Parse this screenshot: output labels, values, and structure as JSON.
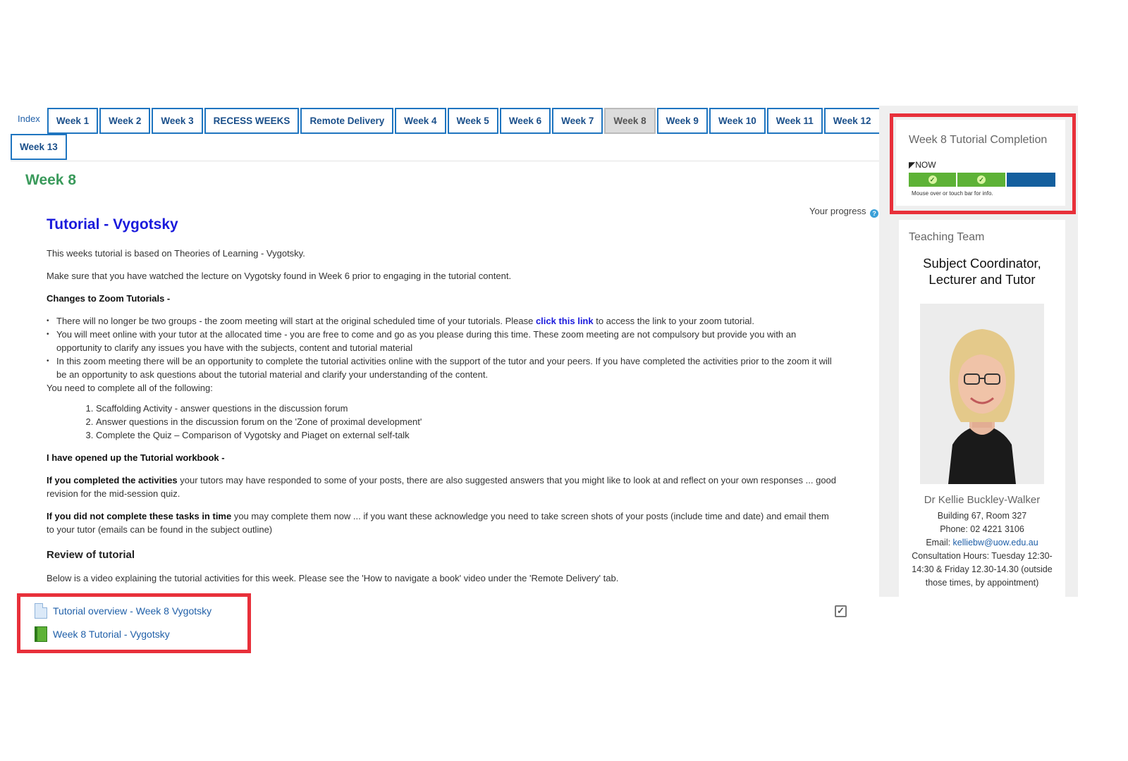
{
  "tabs": {
    "index_label": "Index",
    "items": [
      "Week 1",
      "Week 2",
      "Week 3",
      "RECESS WEEKS",
      "Remote Delivery",
      "Week 4",
      "Week 5",
      "Week 6",
      "Week 7",
      "Week 8",
      "Week 9",
      "Week 10",
      "Week 11",
      "Week 12",
      "Week 13"
    ],
    "active": "Week 8"
  },
  "page": {
    "week_title": "Week 8",
    "your_progress": "Your progress"
  },
  "main": {
    "title": "Tutorial - Vygotsky",
    "intro_1": "This weeks tutorial is based on Theories of Learning - Vygotsky.",
    "intro_2": "Make sure that you have watched the lecture on Vygotsky found in Week 6 prior to engaging in the tutorial content.",
    "changes_heading": "Changes to Zoom Tutorials -",
    "bullet_1_pre": "There will no longer be two groups - the zoom meeting will start at the original scheduled time of your tutorials. Please ",
    "bullet_1_link": "click this link",
    "bullet_1_post": " to access the link to your zoom tutorial.",
    "bullet_2": "You will meet online with your tutor at the allocated time - you are free to come and go as you please during this time. These zoom meeting are not compulsory but provide you with an opportunity to clarify any issues you have with the subjects, content and tutorial material",
    "bullet_3": "In this zoom meeting there will be an opportunity to complete the tutorial activities online with the support of the tutor and your peers. If you have completed the activities prior to the zoom it will be an opportunity to ask questions about the tutorial material and clarify your understanding of the content.",
    "complete_intro": "You need to complete all of the following:",
    "tasks": [
      "Scaffolding Activity - answer questions in the discussion forum",
      "Answer questions in the discussion forum on the 'Zone of proximal development'",
      "Complete the Quiz – Comparison of Vygotsky and Piaget on external self-talk"
    ],
    "workbook_heading": "I have opened up the Tutorial workbook -",
    "completed_bold": "If you completed the activities",
    "completed_text": " your tutors may have responded to some of your posts, there are also suggested answers that you might like to look at and reflect on your own responses ... good revision for the mid-session quiz.",
    "not_completed_bold": "If you did not complete these tasks in time",
    "not_completed_text": " you may complete them now ... if you want these acknowledge you need to take screen shots of your posts (include time and date) and email them to your tutor (emails can be found in the subject outline)",
    "review_heading": "Review of tutorial",
    "review_text": "Below is a video explaining the tutorial activities for this week. Please see the 'How to navigate a book' video under the 'Remote Delivery' tab."
  },
  "resources": [
    {
      "label": "Tutorial overview - Week 8 Vygotsky",
      "icon": "document-icon"
    },
    {
      "label": "Week 8 Tutorial - Vygotsky",
      "icon": "book-icon"
    }
  ],
  "completion": {
    "title": "Week 8 Tutorial Completion",
    "now_label": "NOW",
    "hint": "Mouse over or touch bar for info.",
    "segments": [
      "done",
      "done",
      "todo"
    ],
    "colors": {
      "done": "#5db236",
      "todo": "#145f9e"
    }
  },
  "team": {
    "title": "Teaching Team",
    "role_line_1": "Subject Coordinator,",
    "role_line_2": "Lecturer and Tutor",
    "name": "Dr Kellie Buckley-Walker",
    "building": "Building 67, Room 327",
    "phone": "Phone: 02 4221 3106",
    "email_label": "Email: ",
    "email": "kelliebw@uow.edu.au",
    "consultation": "Consultation Hours: Tuesday 12:30-14:30 & Friday 12.30-14.30 (outside those times, by appointment)"
  },
  "colors": {
    "accent_blue": "#1a1adc",
    "week_green": "#3a9a5b",
    "highlight_red": "#e8303a"
  }
}
